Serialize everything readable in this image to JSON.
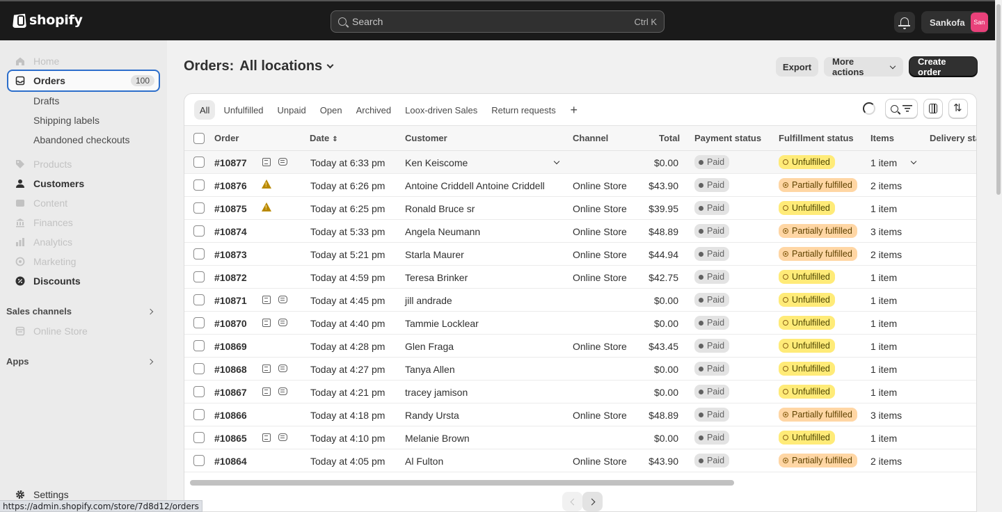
{
  "topbar": {
    "brand": "shopify",
    "search_placeholder": "Search",
    "search_shortcut": "Ctrl K",
    "user_name": "Sankofa",
    "avatar_initials": "San"
  },
  "sidebar": {
    "home": "Home",
    "orders": "Orders",
    "orders_count": "100",
    "drafts": "Drafts",
    "shipping_labels": "Shipping labels",
    "abandoned_checkouts": "Abandoned checkouts",
    "products": "Products",
    "customers": "Customers",
    "content": "Content",
    "finances": "Finances",
    "analytics": "Analytics",
    "marketing": "Marketing",
    "discounts": "Discounts",
    "sales_channels": "Sales channels",
    "online_store": "Online Store",
    "apps": "Apps",
    "settings": "Settings"
  },
  "status_url": "https://admin.shopify.com/store/7d8d12/orders",
  "header": {
    "title_prefix": "Orders:",
    "location": "All locations",
    "export": "Export",
    "more_actions": "More actions",
    "create_order": "Create order"
  },
  "tabs": [
    "All",
    "Unfulfilled",
    "Unpaid",
    "Open",
    "Archived",
    "Loox-driven Sales",
    "Return requests"
  ],
  "tabs_add": "+",
  "columns": {
    "order": "Order",
    "date": "Date",
    "customer": "Customer",
    "channel": "Channel",
    "total": "Total",
    "payment": "Payment status",
    "fulfillment": "Fulfillment status",
    "items": "Items",
    "delivery": "Delivery status"
  },
  "orders": [
    {
      "id": "#10877",
      "note": true,
      "chat": true,
      "warn": false,
      "date": "Today at 6:33 pm",
      "customer": "Ken Keiscome",
      "channel": "",
      "total": "$0.00",
      "payment": "Paid",
      "fulfillment": "Unfulfilled",
      "items": "1 item"
    },
    {
      "id": "#10876",
      "note": false,
      "chat": false,
      "warn": true,
      "date": "Today at 6:26 pm",
      "customer": "Antoine Criddell Antoine Criddell",
      "channel": "Online Store",
      "total": "$43.90",
      "payment": "Paid",
      "fulfillment": "Partially fulfilled",
      "items": "2 items"
    },
    {
      "id": "#10875",
      "note": false,
      "chat": false,
      "warn": true,
      "date": "Today at 6:25 pm",
      "customer": "Ronald Bruce sr",
      "channel": "Online Store",
      "total": "$39.95",
      "payment": "Paid",
      "fulfillment": "Unfulfilled",
      "items": "1 item"
    },
    {
      "id": "#10874",
      "note": false,
      "chat": false,
      "warn": false,
      "date": "Today at 5:33 pm",
      "customer": "Angela Neumann",
      "channel": "Online Store",
      "total": "$48.89",
      "payment": "Paid",
      "fulfillment": "Partially fulfilled",
      "items": "3 items"
    },
    {
      "id": "#10873",
      "note": false,
      "chat": false,
      "warn": false,
      "date": "Today at 5:21 pm",
      "customer": "Starla Maurer",
      "channel": "Online Store",
      "total": "$44.94",
      "payment": "Paid",
      "fulfillment": "Partially fulfilled",
      "items": "2 items"
    },
    {
      "id": "#10872",
      "note": false,
      "chat": false,
      "warn": false,
      "date": "Today at 4:59 pm",
      "customer": "Teresa Brinker",
      "channel": "Online Store",
      "total": "$42.75",
      "payment": "Paid",
      "fulfillment": "Unfulfilled",
      "items": "1 item"
    },
    {
      "id": "#10871",
      "note": true,
      "chat": true,
      "warn": false,
      "date": "Today at 4:45 pm",
      "customer": "jill andrade",
      "channel": "",
      "total": "$0.00",
      "payment": "Paid",
      "fulfillment": "Unfulfilled",
      "items": "1 item"
    },
    {
      "id": "#10870",
      "note": true,
      "chat": true,
      "warn": false,
      "date": "Today at 4:40 pm",
      "customer": "Tammie Locklear",
      "channel": "",
      "total": "$0.00",
      "payment": "Paid",
      "fulfillment": "Unfulfilled",
      "items": "1 item"
    },
    {
      "id": "#10869",
      "note": false,
      "chat": false,
      "warn": false,
      "date": "Today at 4:28 pm",
      "customer": "Glen Fraga",
      "channel": "Online Store",
      "total": "$43.45",
      "payment": "Paid",
      "fulfillment": "Unfulfilled",
      "items": "1 item"
    },
    {
      "id": "#10868",
      "note": true,
      "chat": true,
      "warn": false,
      "date": "Today at 4:27 pm",
      "customer": "Tanya Allen",
      "channel": "",
      "total": "$0.00",
      "payment": "Paid",
      "fulfillment": "Unfulfilled",
      "items": "1 item"
    },
    {
      "id": "#10867",
      "note": true,
      "chat": true,
      "warn": false,
      "date": "Today at 4:21 pm",
      "customer": "tracey jamison",
      "channel": "",
      "total": "$0.00",
      "payment": "Paid",
      "fulfillment": "Unfulfilled",
      "items": "1 item"
    },
    {
      "id": "#10866",
      "note": false,
      "chat": false,
      "warn": false,
      "date": "Today at 4:18 pm",
      "customer": "Randy Ursta",
      "channel": "Online Store",
      "total": "$48.89",
      "payment": "Paid",
      "fulfillment": "Partially fulfilled",
      "items": "3 items"
    },
    {
      "id": "#10865",
      "note": true,
      "chat": true,
      "warn": false,
      "date": "Today at 4:10 pm",
      "customer": "Melanie Brown",
      "channel": "",
      "total": "$0.00",
      "payment": "Paid",
      "fulfillment": "Unfulfilled",
      "items": "1 item"
    },
    {
      "id": "#10864",
      "note": false,
      "chat": false,
      "warn": false,
      "date": "Today at 4:05 pm",
      "customer": "Al Fulton",
      "channel": "Online Store",
      "total": "$43.90",
      "payment": "Paid",
      "fulfillment": "Partially fulfilled",
      "items": "2 items"
    }
  ],
  "colors": {
    "brand_dark": "#1a1a1a",
    "unfulfilled": "#ffeb78",
    "partially_fulfilled": "#ffd6a4",
    "paid": "#e3e3e3",
    "focus_ring": "#2c6ecb",
    "avatar": "#e9417a"
  }
}
